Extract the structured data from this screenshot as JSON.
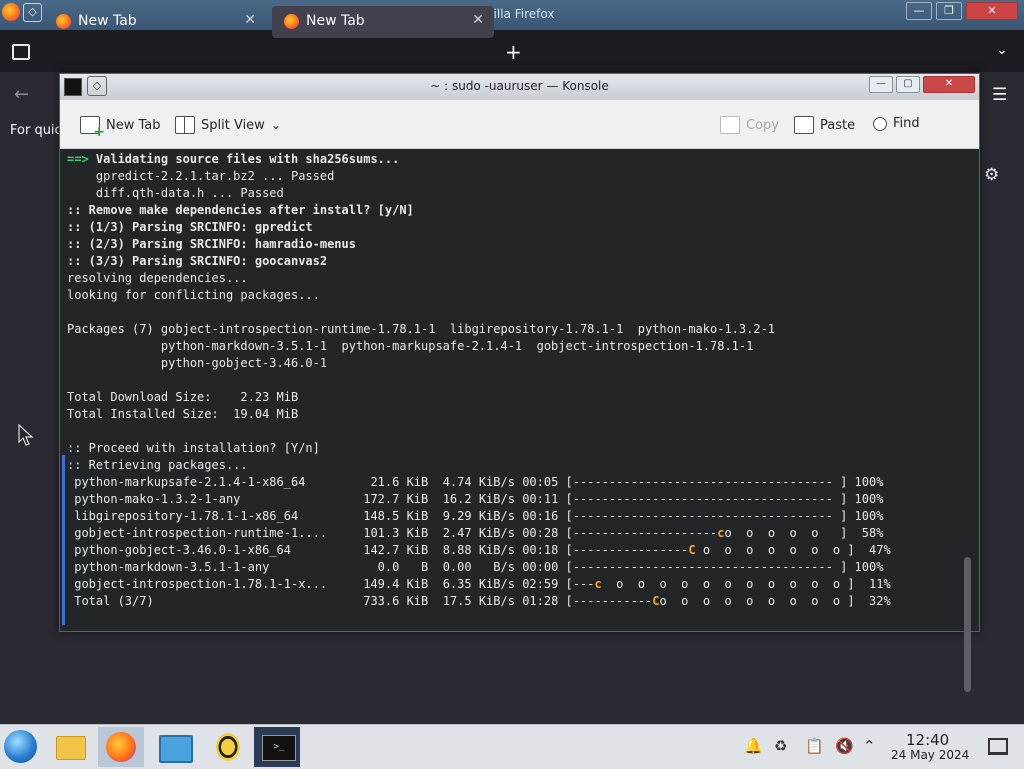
{
  "firefox": {
    "window_title": "Mozilla Firefox",
    "tabs": [
      {
        "label": "New Tab"
      },
      {
        "label": "New Tab"
      }
    ],
    "new_tab_symbol": "+",
    "bookmarks_text": "For quic"
  },
  "konsole": {
    "title": "~ : sudo -uauruser — Konsole",
    "toolbar": {
      "new_tab": "New Tab",
      "split_view": "Split View",
      "copy": "Copy",
      "paste": "Paste",
      "find": "Find"
    },
    "lines": [
      {
        "text": "==> ",
        "cls": "g",
        "rest": "Validating source files with sha256sums...",
        "rest_cls": "b"
      },
      {
        "text": "    gpredict-2.2.1.tar.bz2 ... Passed"
      },
      {
        "text": "    diff.qth-data.h ... Passed"
      },
      {
        "text": ":: Remove make dependencies after install? [y/N]",
        "cls": "b"
      },
      {
        "text": ":: (1/3) Parsing SRCINFO: gpredict",
        "cls": "b"
      },
      {
        "text": ":: (2/3) Parsing SRCINFO: hamradio-menus",
        "cls": "b"
      },
      {
        "text": ":: (3/3) Parsing SRCINFO: goocanvas2",
        "cls": "b"
      },
      {
        "text": "resolving dependencies..."
      },
      {
        "text": "looking for conflicting packages..."
      },
      {
        "text": ""
      },
      {
        "text": "Packages (7) gobject-introspection-runtime-1.78.1-1  libgirepository-1.78.1-1  python-mako-1.3.2-1"
      },
      {
        "text": "             python-markdown-3.5.1-1  python-markupsafe-2.1.4-1  gobject-introspection-1.78.1-1"
      },
      {
        "text": "             python-gobject-3.46.0-1"
      },
      {
        "text": ""
      },
      {
        "text": "Total Download Size:    2.23 MiB"
      },
      {
        "text": "Total Installed Size:  19.04 MiB"
      },
      {
        "text": ""
      },
      {
        "text": ":: Proceed with installation? [Y/n]"
      },
      {
        "text": ":: Retrieving packages..."
      }
    ],
    "downloads": [
      {
        "name": "python-markupsafe-2.1.4-1-x86_64",
        "size": "21.6 KiB",
        "speed": "4.74 KiB/s",
        "time": "00:05",
        "bar_done": "------------------------------------",
        "pac": "",
        "bar_rest": "",
        "percent": "100%"
      },
      {
        "name": "python-mako-1.3.2-1-any",
        "size": "172.7 KiB",
        "speed": "16.2 KiB/s",
        "time": "00:11",
        "bar_done": "------------------------------------",
        "pac": "",
        "bar_rest": "",
        "percent": "100%"
      },
      {
        "name": "libgirepository-1.78.1-1-x86_64",
        "size": "148.5 KiB",
        "speed": "9.29 KiB/s",
        "time": "00:16",
        "bar_done": "------------------------------------",
        "pac": "",
        "bar_rest": "",
        "percent": "100%"
      },
      {
        "name": "gobject-introspection-runtime-1....",
        "size": "101.3 KiB",
        "speed": "2.47 KiB/s",
        "time": "00:28",
        "bar_done": "--------------------",
        "pac": "c",
        "bar_rest": "o  o  o  o  o ",
        "percent": "58%"
      },
      {
        "name": "python-gobject-3.46.0-1-x86_64",
        "size": "142.7 KiB",
        "speed": "8.88 KiB/s",
        "time": "00:18",
        "bar_done": "----------------",
        "pac": "C",
        "bar_rest": " o  o  o  o  o  o  o ",
        "percent": "47%"
      },
      {
        "name": "python-markdown-3.5.1-1-any",
        "size": "0.0",
        "size_unit": "B",
        "speed": "0.00",
        "speed_unit": "B/s",
        "time": "00:00",
        "bar_done": "------------------------------------",
        "pac": "",
        "bar_rest": "",
        "percent": "100%"
      },
      {
        "name": "gobject-introspection-1.78.1-1-x...",
        "size": "149.4 KiB",
        "speed": "6.35 KiB/s",
        "time": "02:59",
        "bar_done": "---",
        "pac": "c",
        "bar_rest": "  o  o  o  o  o  o  o  o  o  o  o ",
        "percent": "11%"
      },
      {
        "name": "Total (3/7)",
        "size": "733.6 KiB",
        "speed": "17.5 KiB/s",
        "time": "01:28",
        "bar_done": "-----------",
        "pac": "C",
        "bar_rest": "o  o  o  o  o  o  o  o  o ",
        "percent": "32%"
      }
    ]
  },
  "taskbar": {
    "clock_time": "12:40",
    "clock_date": "24 May 2024"
  },
  "colors": {
    "accent": "#3d6fd6",
    "terminal_bg": "#232629",
    "green": "#2bd46e",
    "pacman": "#f5a623"
  }
}
